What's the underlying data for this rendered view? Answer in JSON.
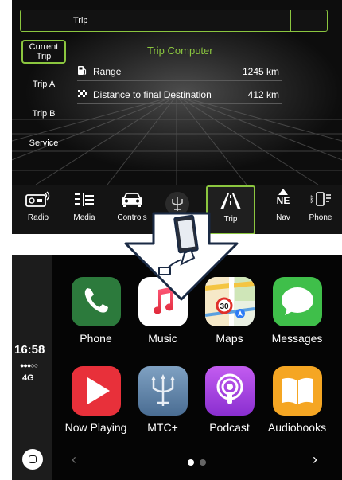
{
  "trip_screen": {
    "title": "Trip",
    "menu": [
      {
        "label": "Current\nTrip",
        "selected": true
      },
      {
        "label": "Trip A"
      },
      {
        "label": "Trip B"
      },
      {
        "label": "Service"
      }
    ],
    "panel_title": "Trip Computer",
    "rows": [
      {
        "icon": "fuel-pump-icon",
        "label": "Range",
        "value": "1245 km"
      },
      {
        "icon": "checkered-flag-icon",
        "label": "Distance to final Destination",
        "value": "412 km"
      }
    ],
    "bottom_bar": [
      {
        "label": "Radio",
        "icon": "radio-icon"
      },
      {
        "label": "Media",
        "icon": "media-icon"
      },
      {
        "label": "Controls",
        "icon": "car-controls-icon"
      },
      {
        "label": "Trip",
        "icon": "road-icon",
        "active": true
      },
      {
        "label": "Nav",
        "icon": "compass-icon",
        "compass_text": "NE"
      },
      {
        "label": "Phone",
        "icon": "phone-bluetooth-icon"
      }
    ],
    "accent_color": "#8bc63f"
  },
  "carplay": {
    "status": {
      "time": "16:58",
      "signal": "●●●○○",
      "network": "4G"
    },
    "apps": [
      {
        "name": "Phone",
        "icon": "phone-app-icon"
      },
      {
        "name": "Music",
        "icon": "music-app-icon"
      },
      {
        "name": "Maps",
        "icon": "maps-app-icon",
        "badge": "30"
      },
      {
        "name": "Messages",
        "icon": "messages-app-icon"
      },
      {
        "name": "Now Playing",
        "icon": "now-playing-app-icon"
      },
      {
        "name": "MTC+",
        "icon": "trident-app-icon"
      },
      {
        "name": "Podcast",
        "icon": "podcast-app-icon"
      },
      {
        "name": "Audiobooks",
        "icon": "audiobooks-app-icon"
      }
    ],
    "page_indicator": {
      "pages": 2,
      "current": 1
    },
    "nav": {
      "prev": "‹",
      "next": "›"
    }
  }
}
